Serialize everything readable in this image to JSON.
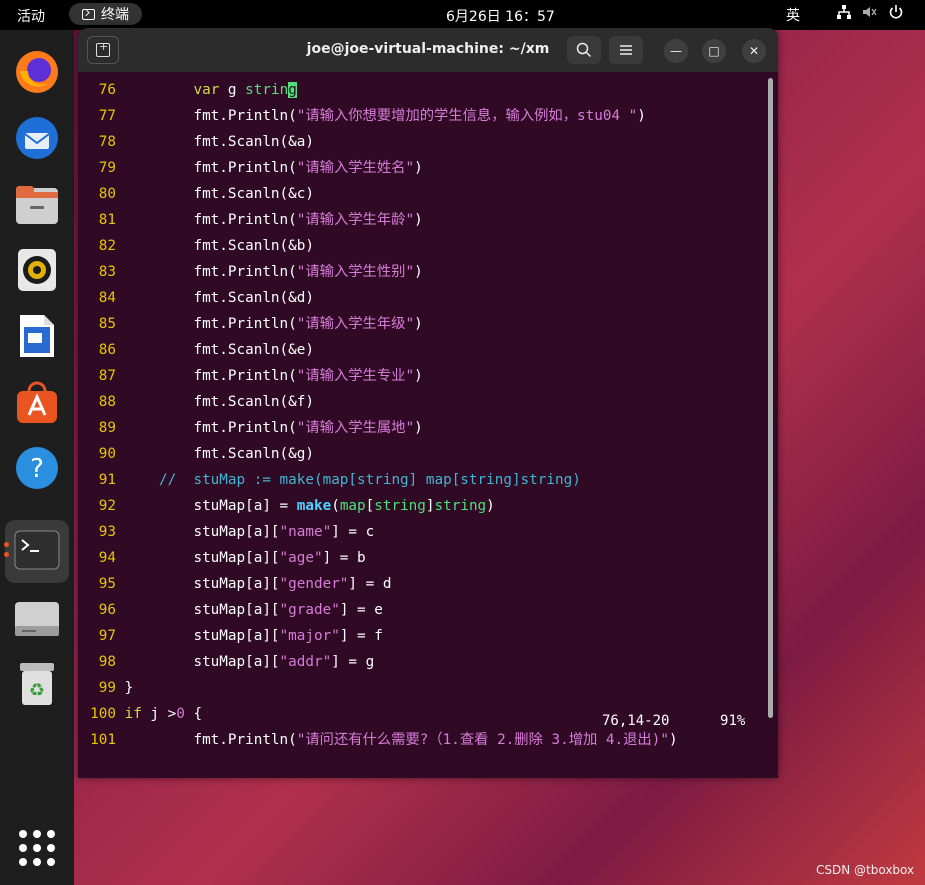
{
  "topbar": {
    "activities": "活动",
    "app_name": "终端",
    "clock": "6月26日  16：57",
    "ime": "英",
    "network_icon": "network-icon",
    "volume_icon": "volume-muted-icon",
    "power_icon": "power-icon"
  },
  "dock": {
    "apps": [
      "firefox",
      "thunderbird",
      "files",
      "rhythmbox",
      "libreoffice-writer",
      "app-center",
      "help",
      "terminal",
      "drive",
      "trash"
    ]
  },
  "window": {
    "title": "joe@joe-virtual-machine: ~/xm",
    "search_icon": "search-icon",
    "menu_icon": "hamburger-menu-icon",
    "min_label": "—",
    "max_label": "□",
    "close_label": "✕"
  },
  "code": [
    {
      "n": "76",
      "segs": [
        [
          "        ",
          ""
        ],
        [
          "var",
          "kw"
        ],
        [
          " g ",
          ""
        ],
        [
          "strin",
          "type"
        ],
        [
          "g",
          "cursor"
        ]
      ]
    },
    {
      "n": "77",
      "segs": [
        [
          "        fmt.Println(",
          ""
        ],
        [
          "\"请输入你想要增加的学生信息，输入例如，stu04 \"",
          "str"
        ],
        [
          ")",
          ""
        ]
      ]
    },
    {
      "n": "78",
      "segs": [
        [
          "        fmt.Scanln(&a)",
          ""
        ]
      ]
    },
    {
      "n": "79",
      "segs": [
        [
          "        fmt.Println(",
          ""
        ],
        [
          "\"请输入学生姓名\"",
          "str"
        ],
        [
          ")",
          ""
        ]
      ]
    },
    {
      "n": "80",
      "segs": [
        [
          "        fmt.Scanln(&c)",
          ""
        ]
      ]
    },
    {
      "n": "81",
      "segs": [
        [
          "        fmt.Println(",
          ""
        ],
        [
          "\"请输入学生年龄\"",
          "str"
        ],
        [
          ")",
          ""
        ]
      ]
    },
    {
      "n": "82",
      "segs": [
        [
          "        fmt.Scanln(&b)",
          ""
        ]
      ]
    },
    {
      "n": "83",
      "segs": [
        [
          "        fmt.Println(",
          ""
        ],
        [
          "\"请输入学生性别\"",
          "str"
        ],
        [
          ")",
          ""
        ]
      ]
    },
    {
      "n": "84",
      "segs": [
        [
          "        fmt.Scanln(&d)",
          ""
        ]
      ]
    },
    {
      "n": "85",
      "segs": [
        [
          "        fmt.Println(",
          ""
        ],
        [
          "\"请输入学生年级\"",
          "str"
        ],
        [
          ")",
          ""
        ]
      ]
    },
    {
      "n": "86",
      "segs": [
        [
          "        fmt.Scanln(&e)",
          ""
        ]
      ]
    },
    {
      "n": "87",
      "segs": [
        [
          "        fmt.Println(",
          ""
        ],
        [
          "\"请输入学生专业\"",
          "str"
        ],
        [
          ")",
          ""
        ]
      ]
    },
    {
      "n": "88",
      "segs": [
        [
          "        fmt.Scanln(&f)",
          ""
        ]
      ]
    },
    {
      "n": "89",
      "segs": [
        [
          "        fmt.Println(",
          ""
        ],
        [
          "\"请输入学生属地\"",
          "str"
        ],
        [
          ")",
          ""
        ]
      ]
    },
    {
      "n": "90",
      "segs": [
        [
          "        fmt.Scanln(&g)",
          ""
        ]
      ]
    },
    {
      "n": "91",
      "segs": [
        [
          "    //  stuMap := make(map[string] map[string]string)",
          "cmt"
        ]
      ]
    },
    {
      "n": "92",
      "segs": [
        [
          "        stuMap[a] = ",
          ""
        ],
        [
          "make",
          "mk"
        ],
        [
          "(",
          ""
        ],
        [
          "map",
          "type"
        ],
        [
          "[",
          ""
        ],
        [
          "string",
          "type"
        ],
        [
          "]",
          ""
        ],
        [
          "string",
          "type"
        ],
        [
          ")",
          ""
        ]
      ]
    },
    {
      "n": "93",
      "segs": [
        [
          "        stuMap[a][",
          ""
        ],
        [
          "\"name\"",
          "str"
        ],
        [
          "] = c",
          ""
        ]
      ]
    },
    {
      "n": "94",
      "segs": [
        [
          "        stuMap[a][",
          ""
        ],
        [
          "\"age\"",
          "str"
        ],
        [
          "] = b",
          ""
        ]
      ]
    },
    {
      "n": "95",
      "segs": [
        [
          "        stuMap[a][",
          ""
        ],
        [
          "\"gender\"",
          "str"
        ],
        [
          "] = d",
          ""
        ]
      ]
    },
    {
      "n": "96",
      "segs": [
        [
          "        stuMap[a][",
          ""
        ],
        [
          "\"grade\"",
          "str"
        ],
        [
          "] = e",
          ""
        ]
      ]
    },
    {
      "n": "97",
      "segs": [
        [
          "        stuMap[a][",
          ""
        ],
        [
          "\"major\"",
          "str"
        ],
        [
          "] = f",
          ""
        ]
      ]
    },
    {
      "n": "98",
      "segs": [
        [
          "        stuMap[a][",
          ""
        ],
        [
          "\"addr\"",
          "str"
        ],
        [
          "] = g",
          ""
        ]
      ]
    },
    {
      "n": "99",
      "segs": [
        [
          "}",
          ""
        ]
      ]
    },
    {
      "n": "100",
      "segs": [
        [
          "if",
          "kw"
        ],
        [
          " j >",
          ""
        ],
        [
          "0",
          "str"
        ],
        [
          " {",
          ""
        ]
      ]
    },
    {
      "n": "101",
      "segs": [
        [
          "        fmt.Println(",
          ""
        ],
        [
          "\"请问还有什么需要?（1.查看 2.删除 3.增加 4.退出)\"",
          "str"
        ],
        [
          ")",
          ""
        ]
      ]
    }
  ],
  "status": {
    "position": "76,14-20",
    "percent": "91%"
  },
  "watermark": "CSDN @tboxbox"
}
